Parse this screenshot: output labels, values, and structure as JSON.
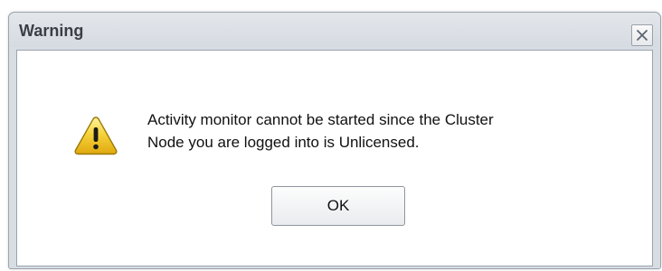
{
  "dialog": {
    "title": "Warning",
    "close_icon": "close-icon",
    "icon": "warning-icon",
    "message_line1": "Activity monitor cannot be started since the Cluster",
    "message_line2": "Node you are logged into is Unlicensed.",
    "ok_label": "OK"
  },
  "colors": {
    "warning_fill": "#f2c81f",
    "warning_stroke": "#8a6d00",
    "title_text": "#3a3f47",
    "frame": "#d8dde3"
  }
}
